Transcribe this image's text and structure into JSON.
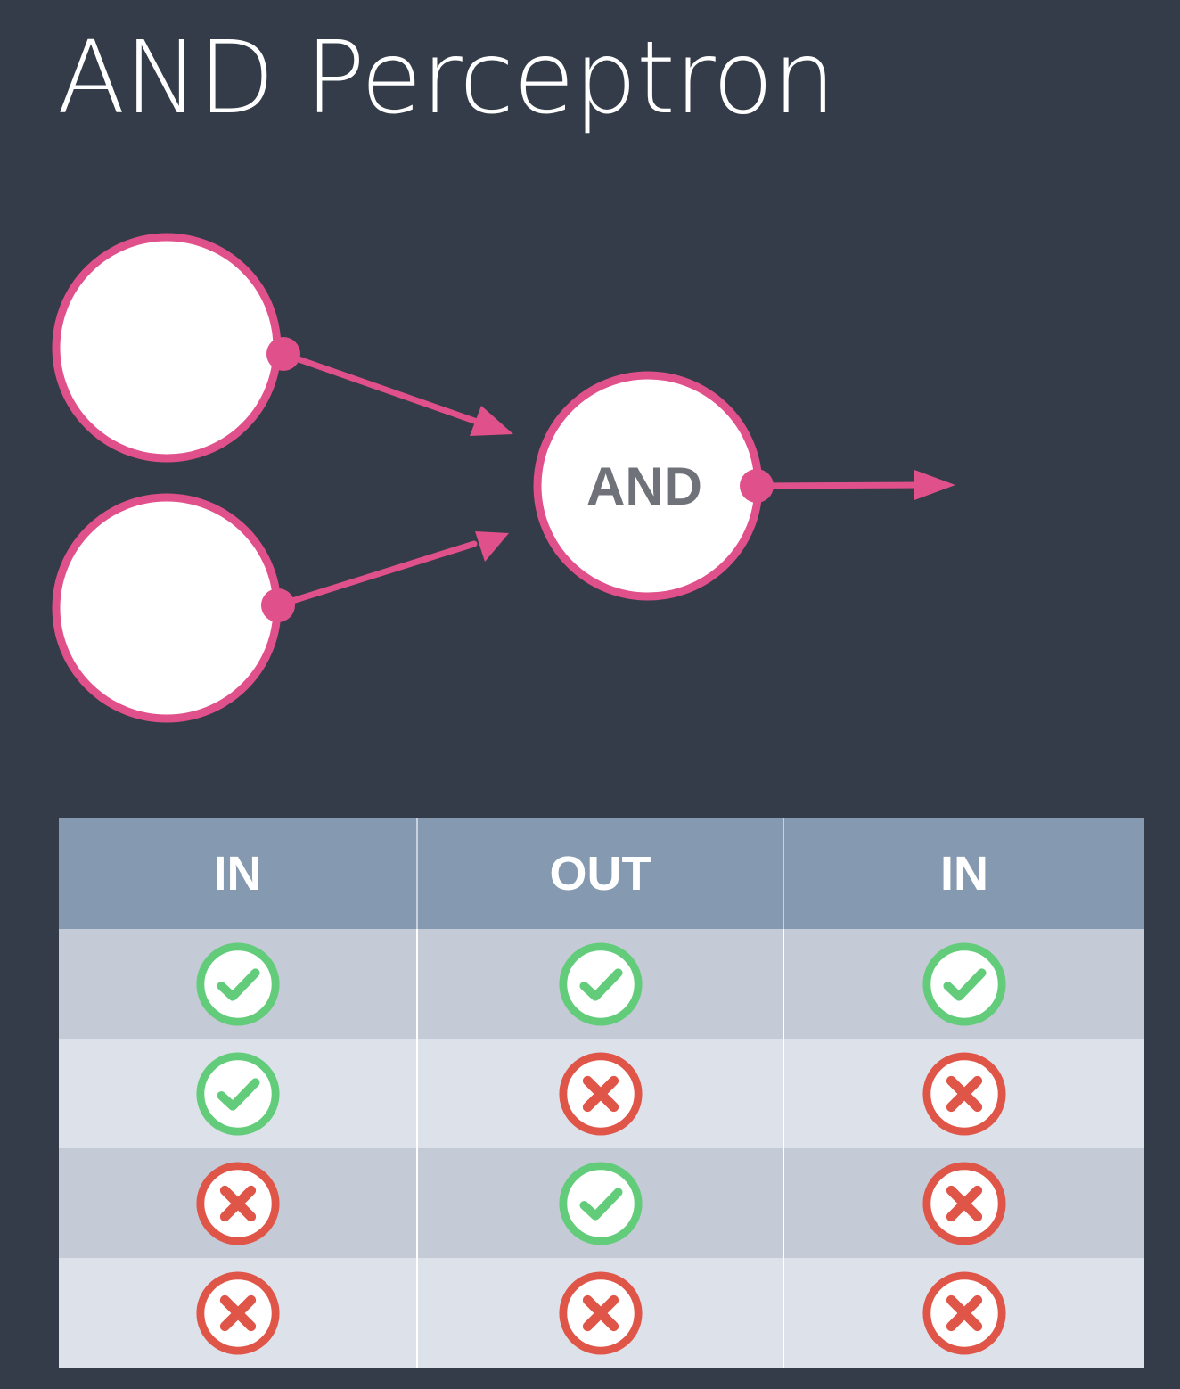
{
  "title": "AND Perceptron",
  "node": {
    "label": "AND"
  },
  "colors": {
    "background": "#333c48",
    "accent": "#e0508a",
    "table_header": "#8599b0",
    "check": "#62cc7a",
    "cross": "#df5548"
  },
  "table": {
    "headers": [
      "IN",
      "OUT",
      "IN"
    ],
    "rows": [
      [
        "check",
        "check",
        "check"
      ],
      [
        "check",
        "cross",
        "cross"
      ],
      [
        "cross",
        "check",
        "cross"
      ],
      [
        "cross",
        "cross",
        "cross"
      ]
    ]
  }
}
